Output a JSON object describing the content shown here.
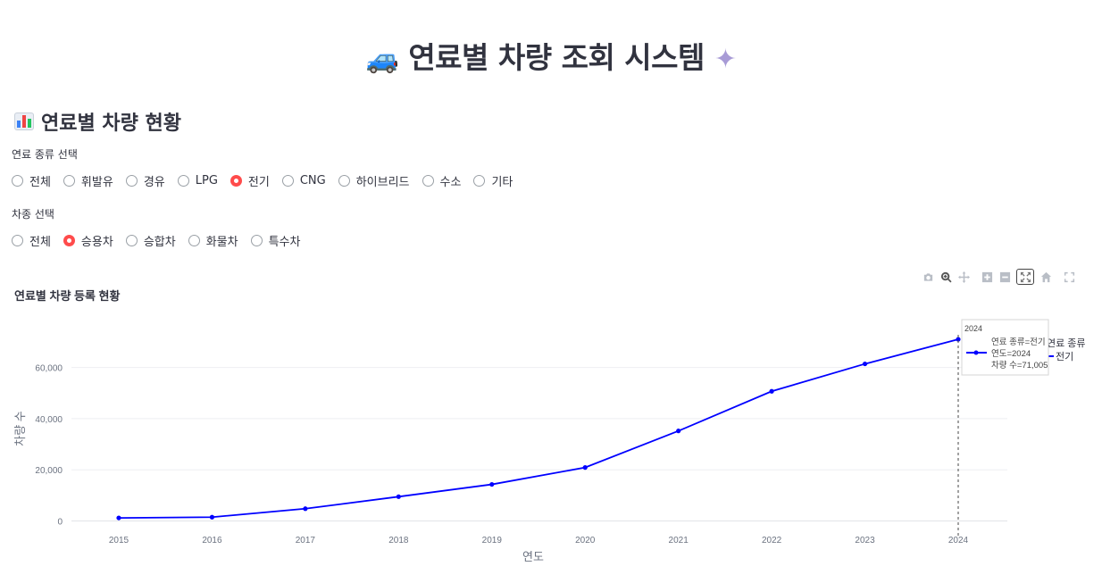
{
  "app": {
    "title": "연료별 차량 조회 시스템",
    "title_icon_left": "car-emoji",
    "title_icon_right": "sparkle-emoji"
  },
  "section": {
    "title": "연료별 차량 현황",
    "icon": "bar-chart-icon"
  },
  "fuel_filter": {
    "label": "연료 종류 선택",
    "options": [
      "전체",
      "휘발유",
      "경유",
      "LPG",
      "전기",
      "CNG",
      "하이브리드",
      "수소",
      "기타"
    ],
    "selected": "전기"
  },
  "vehicle_filter": {
    "label": "차종 선택",
    "options": [
      "전체",
      "승용차",
      "승합차",
      "화물차",
      "특수차"
    ],
    "selected": "승용차"
  },
  "modebar": {
    "buttons": [
      "camera-icon",
      "zoom-icon",
      "pan-icon",
      "zoom-in-icon",
      "zoom-out-icon",
      "autoscale-icon",
      "home-icon",
      "fullscreen-icon"
    ],
    "active": "autoscale-icon"
  },
  "chart_data": {
    "type": "line",
    "title": "연료별 차량 등록 현황",
    "xlabel": "연도",
    "ylabel": "차량 수",
    "x": [
      2015,
      2016,
      2017,
      2018,
      2019,
      2020,
      2021,
      2022,
      2023,
      2024
    ],
    "series": [
      {
        "name": "전기",
        "values": [
          1200,
          1500,
          4800,
          9500,
          14300,
          20900,
          35200,
          50700,
          61400,
          71005
        ],
        "color": "#0000ff"
      }
    ],
    "yticks": [
      "0",
      "20,000",
      "40,000",
      "60,000"
    ],
    "ytick_values": [
      0,
      20000,
      40000,
      60000
    ],
    "xticks": [
      "2015",
      "2016",
      "2017",
      "2018",
      "2019",
      "2020",
      "2021",
      "2022",
      "2023",
      "2024"
    ],
    "ylim": [
      -4000,
      78000
    ],
    "legend": {
      "title": "연료 종류",
      "position": "right"
    },
    "hover": {
      "header": "2024",
      "line1": "연료 종류=전기",
      "line2": "연도=2024",
      "line3": "차량 수=71,005"
    },
    "grid": true
  }
}
